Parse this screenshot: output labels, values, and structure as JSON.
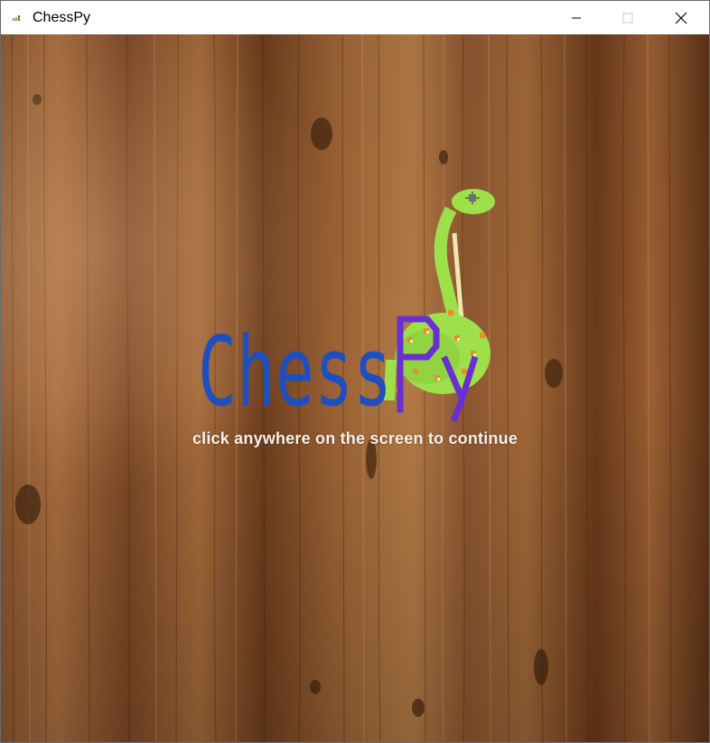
{
  "window": {
    "title": "ChessPy",
    "controls": {
      "minimize": "minimize",
      "maximize": "maximize",
      "close": "close"
    }
  },
  "splash": {
    "logo_text": "ChessPy",
    "prompt": "click anywhere on the screen to continue"
  },
  "colors": {
    "logo_chess": "#1f4fbf",
    "logo_py": "#6a2fd0",
    "snake_green": "#9ee04a",
    "wood_light": "#b0713c",
    "wood_dark": "#5e3518",
    "prompt_text": "#f4f0ea"
  },
  "icons": {
    "app": "chess-app-icon",
    "minimize": "minimize-icon",
    "maximize": "maximize-icon",
    "close": "close-icon"
  }
}
